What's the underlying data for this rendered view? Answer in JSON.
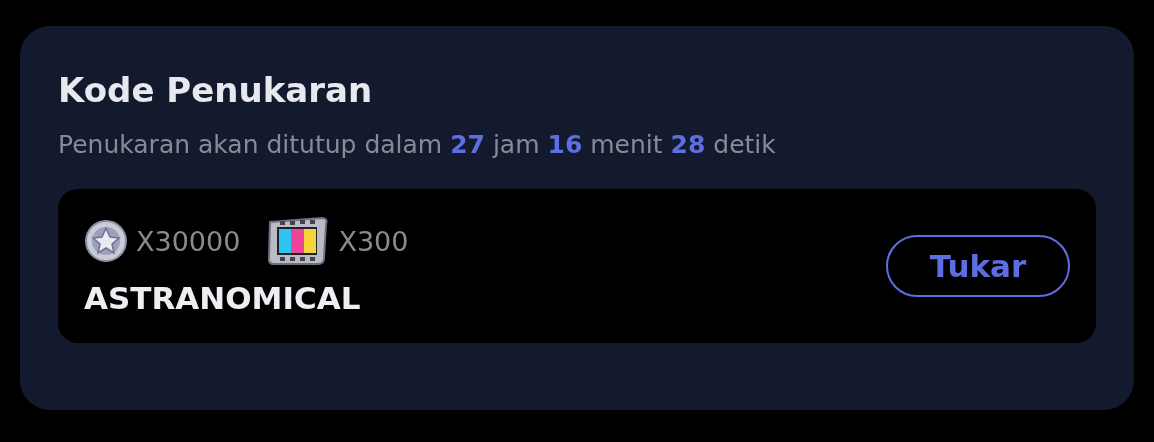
{
  "title": "Kode Penukaran",
  "countdown": [
    {
      "kind": "plain",
      "text": "Penukaran akan ditutup dalam"
    },
    {
      "kind": "number",
      "text": "27"
    },
    {
      "kind": "plain",
      "text": "jam"
    },
    {
      "kind": "number",
      "text": "16"
    },
    {
      "kind": "plain",
      "text": "menit"
    },
    {
      "kind": "number",
      "text": "28"
    },
    {
      "kind": "plain",
      "text": "detik"
    }
  ],
  "code_entry": {
    "rewards": [
      {
        "kind": "coin",
        "amount": "X30000"
      },
      {
        "kind": "film",
        "amount": "X300"
      }
    ],
    "code": "ASTRANOMICAL",
    "button": "Tukar"
  }
}
